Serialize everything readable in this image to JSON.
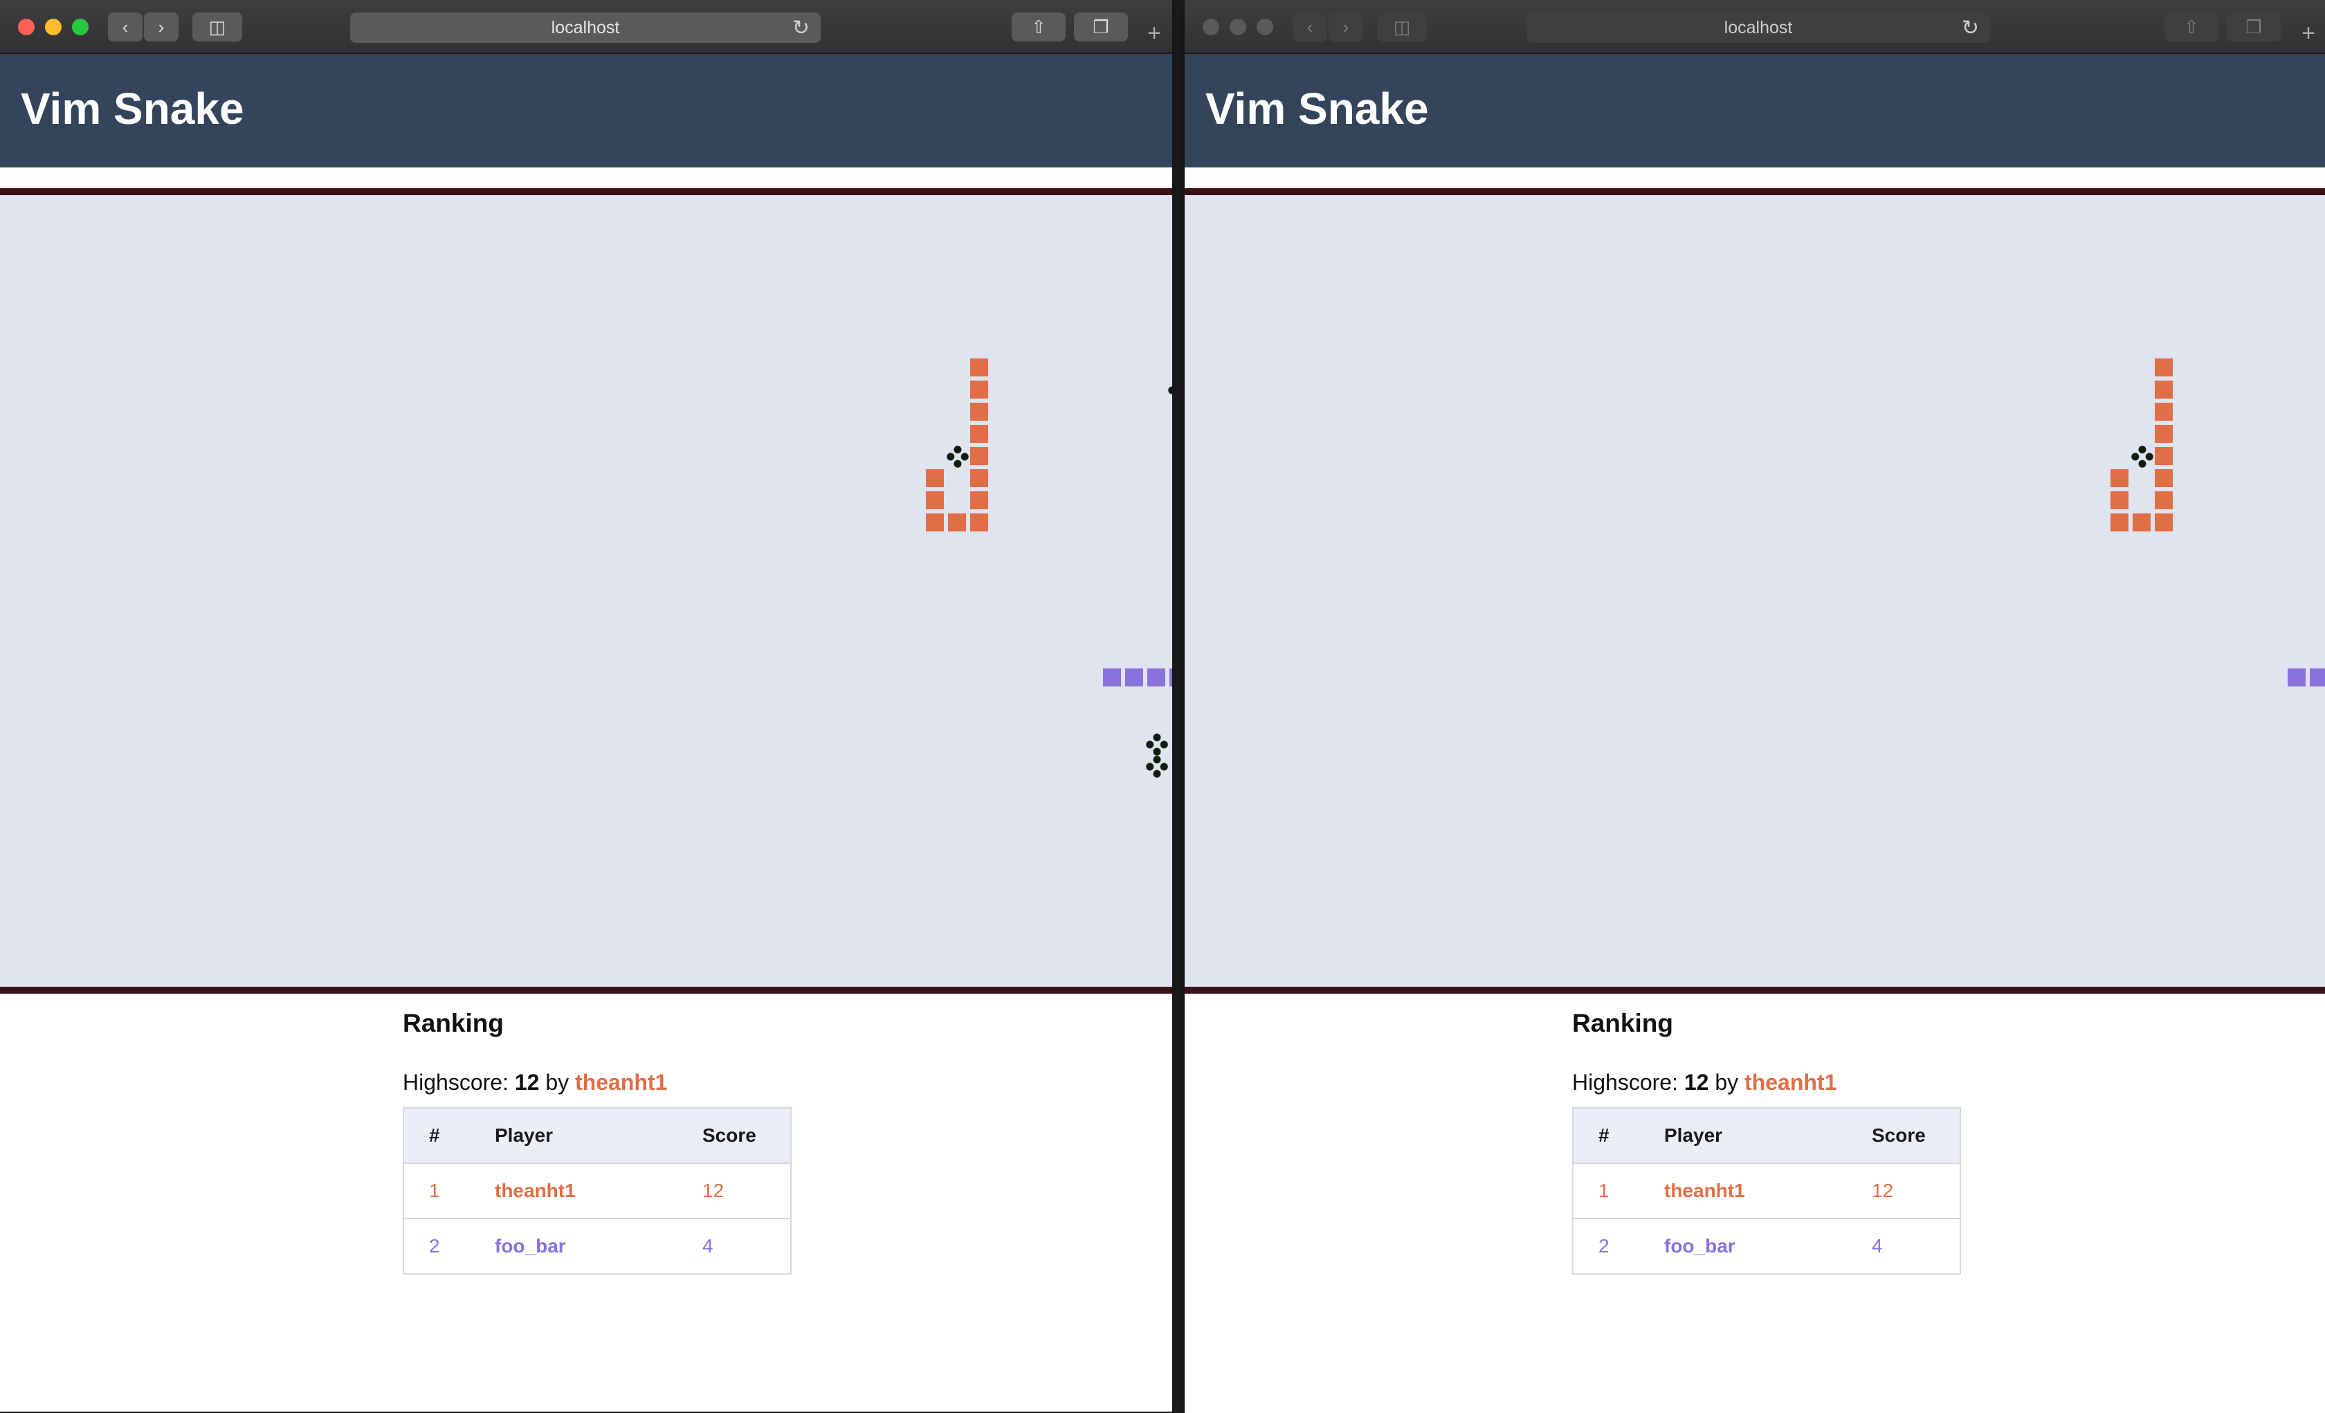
{
  "browser": {
    "url": "localhost"
  },
  "page": {
    "title": "Vim Snake"
  },
  "colors": {
    "header_bg": "#34445b",
    "board_bg": "#dfe4ee",
    "board_border": "#3a1218",
    "player1": "#e06e46",
    "player2": "#8a72dc",
    "food": "#101d0e"
  },
  "game": {
    "grid_cell_units": "cells",
    "snakes": [
      {
        "player": "theanht1",
        "color": "#e06e46",
        "cells": [
          [
            15,
            2
          ],
          [
            15,
            3
          ],
          [
            15,
            4
          ],
          [
            15,
            5
          ],
          [
            15,
            6
          ],
          [
            15,
            7
          ],
          [
            15,
            8
          ],
          [
            15,
            9
          ],
          [
            14,
            9
          ],
          [
            13,
            9
          ],
          [
            13,
            8
          ],
          [
            13,
            7
          ]
        ]
      },
      {
        "player": "foo_bar",
        "color": "#8a72dc",
        "cells": [
          [
            21,
            16
          ],
          [
            22,
            16
          ],
          [
            23,
            16
          ],
          [
            24,
            16
          ]
        ]
      }
    ],
    "food": [
      [
        24,
        3
      ],
      [
        14,
        6
      ],
      [
        23,
        19
      ],
      [
        23,
        20
      ]
    ]
  },
  "ranking": {
    "title": "Ranking",
    "highscore_prefix": "Highscore:",
    "highscore_value": "12",
    "highscore_by": "by",
    "highscore_player": "theanht1",
    "columns": [
      "#",
      "Player",
      "Score"
    ],
    "rows": [
      {
        "rank": "1",
        "player": "theanht1",
        "score": "12"
      },
      {
        "rank": "2",
        "player": "foo_bar",
        "score": "4"
      }
    ]
  },
  "icons": [
    "back-icon",
    "forward-icon",
    "sidebar-icon",
    "reload-icon",
    "share-icon",
    "tabs-icon",
    "new-tab-icon"
  ]
}
